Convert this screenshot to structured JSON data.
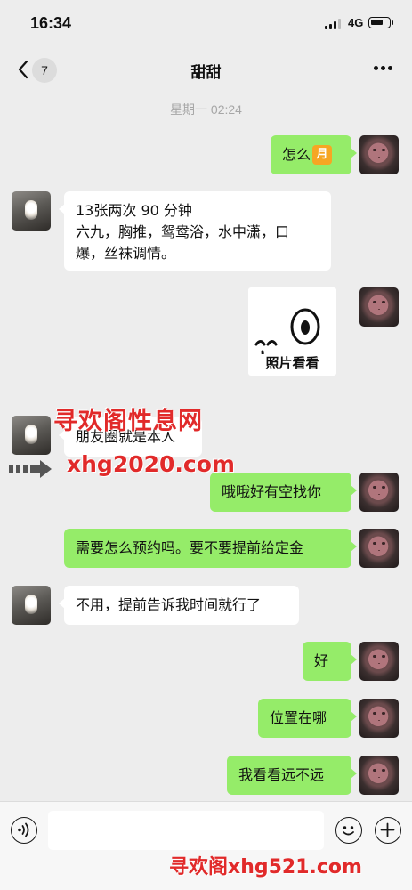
{
  "status_bar": {
    "time": "16:34",
    "network": "4G",
    "battery_level": 0.7
  },
  "nav": {
    "unread_count": "7",
    "title": "甜甜",
    "more_icon": "more-dots-icon",
    "back_icon": "chevron-left-icon"
  },
  "timestamp": "星期一 02:24",
  "messages": [
    {
      "from": "me",
      "text": "怎么",
      "emoji": "月"
    },
    {
      "from": "her",
      "lines": [
        "13张两次 90 分钟",
        "六九，胸推，鸳鸯浴，水中潇，口",
        "爆，丝袜调情。"
      ]
    },
    {
      "from": "me",
      "type": "image",
      "caption": "照片看看"
    },
    {
      "from": "her",
      "text": "朋友圈就是本人"
    },
    {
      "from": "me",
      "text": "哦哦好有空找你"
    },
    {
      "from": "me",
      "text": "需要怎么预约吗。要不要提前给定金"
    },
    {
      "from": "her",
      "text": "不用，提前告诉我时间就行了"
    },
    {
      "from": "me",
      "text": "好"
    },
    {
      "from": "me",
      "text": "位置在哪"
    },
    {
      "from": "me",
      "text": "我看看远不远"
    }
  ],
  "watermarks": {
    "line1": "寻欢阁性息网",
    "line2": "xhg2020.com",
    "bottom": "寻欢阁xhg521.com"
  },
  "input_bar": {
    "voice_icon": "voice-icon",
    "emoji_icon": "emoji-icon",
    "plus_icon": "plus-icon"
  },
  "colors": {
    "me_bubble": "#95ec69",
    "her_bubble": "#ffffff",
    "background": "#ededed",
    "watermark": "#e12a2a"
  }
}
